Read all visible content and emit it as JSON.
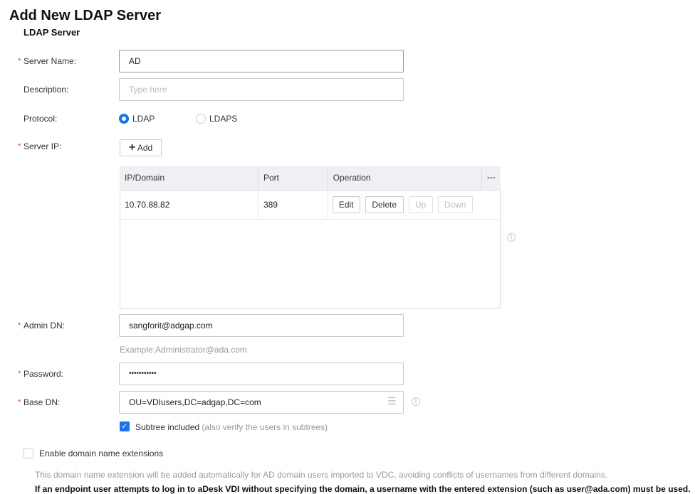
{
  "title": "Add New LDAP Server",
  "section": "LDAP Server",
  "fields": {
    "server_name": {
      "label": "Server Name:",
      "value": "AD"
    },
    "description": {
      "label": "Description:",
      "placeholder": "Type here"
    },
    "protocol": {
      "label": "Protocol:",
      "options": [
        "LDAP",
        "LDAPS"
      ],
      "selected": "LDAP"
    },
    "server_ip": {
      "label": "Server IP:",
      "add_label": "Add"
    },
    "admin_dn": {
      "label": "Admin DN:",
      "value": "sangforit@adgap.com",
      "hint": "Example:Administrator@ada.com"
    },
    "password": {
      "label": "Password:",
      "value": "•••••••••••"
    },
    "base_dn": {
      "label": "Base DN:",
      "value": "OU=VDIusers,DC=adgap,DC=com"
    },
    "subtree": {
      "label": "Subtree included",
      "note": "(also verify the users in subtrees)",
      "checked": true
    },
    "domain_ext": {
      "label": "Enable domain name extensions",
      "checked": false,
      "note": "This domain name extension will be added automatically for AD domain users imported to VDC, avoiding conflicts of usernames from different domains.",
      "warning": "If an endpoint user attempts to log in to aDesk VDI without specifying the domain, a username with the entered extension (such as user@ada.com) must be used."
    }
  },
  "table": {
    "columns": [
      "IP/Domain",
      "Port",
      "Operation",
      "···"
    ],
    "rows": [
      {
        "ip": "10.70.88.82",
        "port": "389",
        "actions": [
          "Edit",
          "Delete",
          "Up",
          "Down"
        ]
      }
    ]
  },
  "colors": {
    "accent": "#1a73e8",
    "required": "#e04040"
  }
}
